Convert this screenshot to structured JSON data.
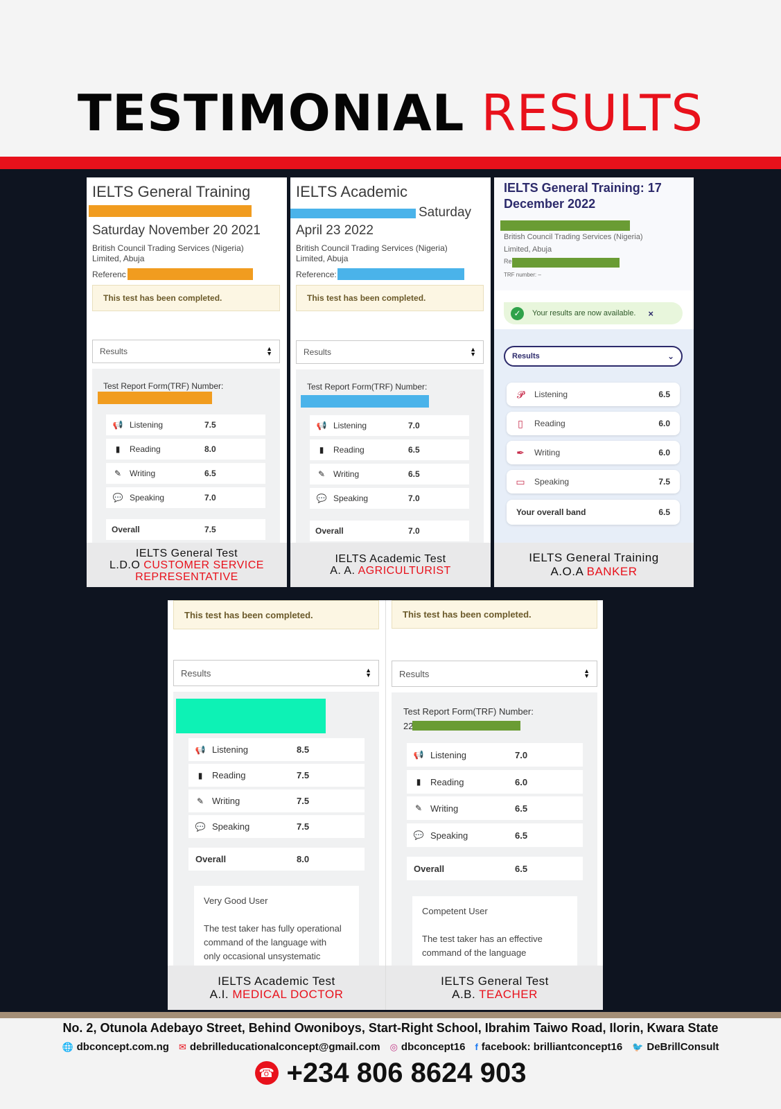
{
  "header": {
    "title_part1": "TESTIMONIAL",
    "title_part2": "RESULTS"
  },
  "colors": {
    "accent_red": "#e8111b",
    "dark_bg": "#0e1420",
    "orange_redact": "#f19c1f",
    "blue_redact": "#4ab3ea",
    "green_redact": "#6a9c34",
    "teal_redact": "#0df2b5"
  },
  "card1": {
    "title": "IELTS General Training",
    "date": "Saturday November 20 2021",
    "center_line1": "British Council Trading Services (Nigeria)",
    "center_line2": "Limited, Abuja",
    "reference_label": "Referenc",
    "completed": "This test has been completed.",
    "select": "Results",
    "trf_label": "Test Report Form(TRF) Number:",
    "scores": [
      {
        "icon": "megaphone-icon",
        "glyph": "📢",
        "label": "Listening",
        "value": "7.5"
      },
      {
        "icon": "book-icon",
        "glyph": "▮",
        "label": "Reading",
        "value": "8.0"
      },
      {
        "icon": "pencil-icon",
        "glyph": "✎",
        "label": "Writing",
        "value": "6.5"
      },
      {
        "icon": "speech-icon",
        "glyph": "💬",
        "label": "Speaking",
        "value": "7.0"
      }
    ],
    "overall_label": "Overall",
    "overall_value": "7.5",
    "caption_line1": "IELTS General Test",
    "caption_name": "L.D.O",
    "caption_job1": "CUSTOMER SERVICE",
    "caption_job2": "REPRESENTATIVE"
  },
  "card2": {
    "title": "IELTS Academic",
    "date_part1": "Saturday",
    "date_part2": "April 23 2022",
    "center_line1": "British Council Trading Services (Nigeria)",
    "center_line2": "Limited, Abuja",
    "reference_label": "Reference:",
    "completed": "This test has been completed.",
    "select": "Results",
    "trf_label": "Test Report Form(TRF) Number:",
    "scores": [
      {
        "icon": "megaphone-icon",
        "glyph": "📢",
        "label": "Listening",
        "value": "7.0"
      },
      {
        "icon": "book-icon",
        "glyph": "▮",
        "label": "Reading",
        "value": "6.5"
      },
      {
        "icon": "pencil-icon",
        "glyph": "✎",
        "label": "Writing",
        "value": "6.5"
      },
      {
        "icon": "speech-icon",
        "glyph": "💬",
        "label": "Speaking",
        "value": "7.0"
      }
    ],
    "overall_label": "Overall",
    "overall_value": "7.0",
    "caption_line1": "IELTS Academic Test",
    "caption_name": "A. A.",
    "caption_job": "AGRICULTURIST"
  },
  "card3": {
    "title_line1": "IELTS General Training: 17",
    "title_line2": "December 2022",
    "center_line1": "British Council Trading Services (Nigeria)",
    "center_line2": "Limited, Abuja",
    "ref_label": "Re",
    "trf_label": "TRF number: –",
    "banner": "Your results are now available.",
    "banner_close": "×",
    "select": "Results",
    "scores": [
      {
        "icon": "ear-icon",
        "glyph": "𝓟",
        "label": "Listening",
        "value": "6.5"
      },
      {
        "icon": "book-icon",
        "glyph": "▯",
        "label": "Reading",
        "value": "6.0"
      },
      {
        "icon": "pen-icon",
        "glyph": "✒",
        "label": "Writing",
        "value": "6.0"
      },
      {
        "icon": "speech-icon",
        "glyph": "▭",
        "label": "Speaking",
        "value": "7.5"
      }
    ],
    "overall_label": "Your overall band",
    "overall_value": "6.5",
    "caption_line1": "IELTS General Training",
    "caption_name": "A.O.A",
    "caption_job": "BANKER"
  },
  "card4": {
    "completed": "This test has been completed.",
    "select": "Results",
    "scores": [
      {
        "icon": "megaphone-icon",
        "glyph": "📢",
        "label": "Listening",
        "value": "8.5"
      },
      {
        "icon": "book-icon",
        "glyph": "▮",
        "label": "Reading",
        "value": "7.5"
      },
      {
        "icon": "pencil-icon",
        "glyph": "✎",
        "label": "Writing",
        "value": "7.5"
      },
      {
        "icon": "speech-icon",
        "glyph": "💬",
        "label": "Speaking",
        "value": "7.5"
      }
    ],
    "overall_label": "Overall",
    "overall_value": "8.0",
    "desc_title": "Very Good User",
    "desc_line1": "The test taker has fully operational",
    "desc_line2": "command of the language with",
    "desc_line3": "only occasional unsystematic",
    "caption_line1": "IELTS Academic Test",
    "caption_name": "A.I.",
    "caption_job": "MEDICAL DOCTOR"
  },
  "card5": {
    "completed": "This test has been completed.",
    "select": "Results",
    "trf_label": "Test Report Form(TRF) Number:",
    "trf_prefix": "22",
    "scores": [
      {
        "icon": "megaphone-icon",
        "glyph": "📢",
        "label": "Listening",
        "value": "7.0"
      },
      {
        "icon": "book-icon",
        "glyph": "▮",
        "label": "Reading",
        "value": "6.0"
      },
      {
        "icon": "pencil-icon",
        "glyph": "✎",
        "label": "Writing",
        "value": "6.5"
      },
      {
        "icon": "speech-icon",
        "glyph": "💬",
        "label": "Speaking",
        "value": "6.5"
      }
    ],
    "overall_label": "Overall",
    "overall_value": "6.5",
    "desc_title": "Competent User",
    "desc_line1": "The test taker has an effective",
    "desc_line2": "command of the language",
    "caption_line1": "IELTS General Test",
    "caption_name": "A.B.",
    "caption_job": "TEACHER"
  },
  "footer": {
    "address": "No. 2, Otunola Adebayo Street, Behind Owoniboys, Start-Right School, Ibrahim Taiwo Road, Ilorin, Kwara State",
    "website": "dbconcept.com.ng",
    "email": "debrilleducationalconcept@gmail.com",
    "instagram": "dbconcept16",
    "facebook": "facebook: brilliantconcept16",
    "twitter": "DeBrillConsult",
    "phone": "+234 806 8624 903"
  }
}
